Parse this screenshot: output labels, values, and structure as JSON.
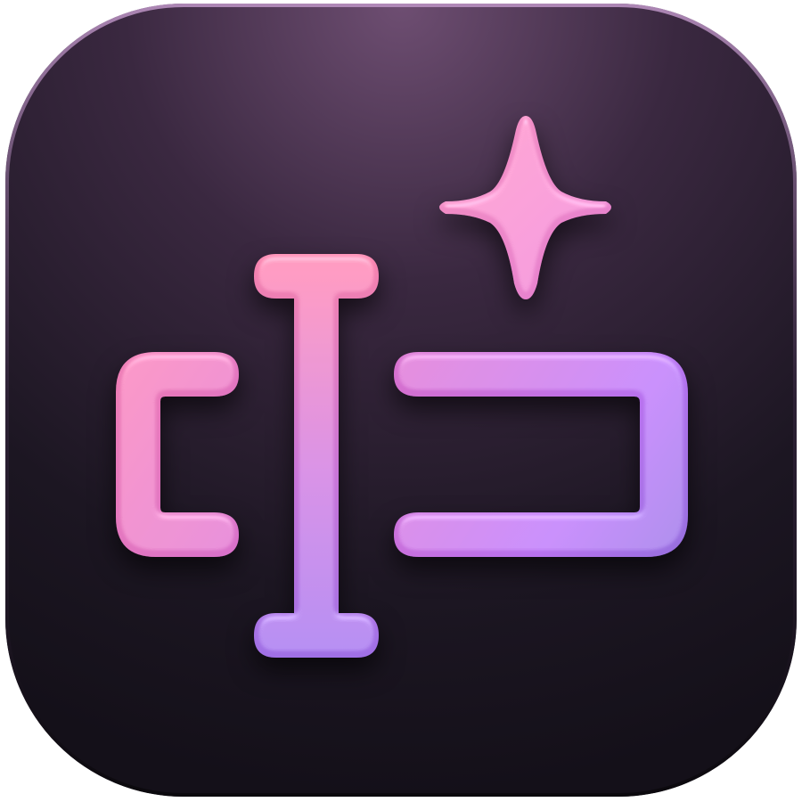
{
  "app_icon": {
    "icon_name": "text-cursor-field-sparkle-icon",
    "parts": {
      "background": "rounded-square-tile",
      "left_bracket": "open-bracket-shape",
      "cursor": "i-beam-text-cursor",
      "field": "text-input-field-outline",
      "sparkle": "four-point-sparkle"
    },
    "colors": {
      "tile_top": "#6a4a6e",
      "tile_mid": "#2e1f33",
      "tile_bottom": "#15111b",
      "pink": "#f080b0",
      "magenta": "#d870c8",
      "violet": "#b070e8",
      "lavender": "#9070e0",
      "sparkle": "#f08ac8"
    }
  }
}
